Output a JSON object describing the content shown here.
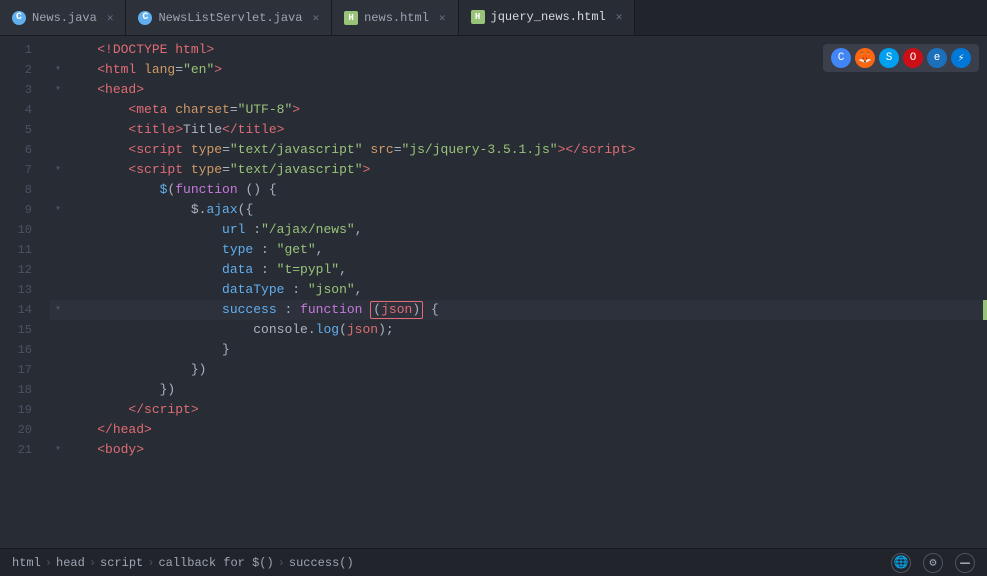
{
  "tabs": [
    {
      "id": "news-java",
      "label": "News.java",
      "color": "#61afef",
      "active": false
    },
    {
      "id": "newslist-servlet",
      "label": "NewsListServlet.java",
      "color": "#61afef",
      "active": false
    },
    {
      "id": "news-html",
      "label": "news.html",
      "color": "#98c379",
      "active": false
    },
    {
      "id": "jquery-news-html",
      "label": "jquery_news.html",
      "color": "#98c379",
      "active": true
    }
  ],
  "lines": [
    {
      "num": 1,
      "indent": 1,
      "fold": false,
      "content": "<!DOCTYPE html>"
    },
    {
      "num": 2,
      "indent": 1,
      "fold": true,
      "content": "<html lang=\"en\">"
    },
    {
      "num": 3,
      "indent": 1,
      "fold": true,
      "content": "<head>"
    },
    {
      "num": 4,
      "indent": 2,
      "fold": false,
      "content": "<meta charset=\"UTF-8\">"
    },
    {
      "num": 5,
      "indent": 2,
      "fold": false,
      "content": "<title>Title</title>"
    },
    {
      "num": 6,
      "indent": 2,
      "fold": false,
      "content": "<script type=\"text/javascript\" src=\"js/jquery-3.5.1.js\"></script>"
    },
    {
      "num": 7,
      "indent": 2,
      "fold": true,
      "content": "<script type=\"text/javascript\">"
    },
    {
      "num": 8,
      "indent": 3,
      "fold": false,
      "content": "$(function () {"
    },
    {
      "num": 9,
      "indent": 4,
      "fold": true,
      "content": "$.ajax({"
    },
    {
      "num": 10,
      "indent": 5,
      "fold": false,
      "content": "url :\"/ajax/news\","
    },
    {
      "num": 11,
      "indent": 5,
      "fold": false,
      "content": "type : \"get\","
    },
    {
      "num": 12,
      "indent": 5,
      "fold": false,
      "content": "data : \"t=pypl\","
    },
    {
      "num": 13,
      "indent": 5,
      "fold": false,
      "content": "dataType : \"json\","
    },
    {
      "num": 14,
      "indent": 5,
      "fold": true,
      "content": "success : function (json) {",
      "highlight_param": true
    },
    {
      "num": 15,
      "indent": 6,
      "fold": false,
      "content": "console.log(json);"
    },
    {
      "num": 16,
      "indent": 5,
      "fold": false,
      "content": "}"
    },
    {
      "num": 17,
      "indent": 4,
      "fold": false,
      "content": "})"
    },
    {
      "num": 18,
      "indent": 3,
      "fold": false,
      "content": "})"
    },
    {
      "num": 19,
      "indent": 2,
      "fold": false,
      "content": "</script>"
    },
    {
      "num": 20,
      "indent": 1,
      "fold": false,
      "content": "</head>"
    },
    {
      "num": 21,
      "indent": 1,
      "fold": true,
      "content": "<body>"
    }
  ],
  "breadcrumb": [
    "html",
    "head",
    "script",
    "callback for $()",
    "success()"
  ],
  "browser_icons": [
    "🌐",
    "🔥",
    "🧭",
    "🔴",
    "🔵",
    "⚡"
  ],
  "status_icons": [
    "🌐",
    "⚙",
    "—"
  ]
}
